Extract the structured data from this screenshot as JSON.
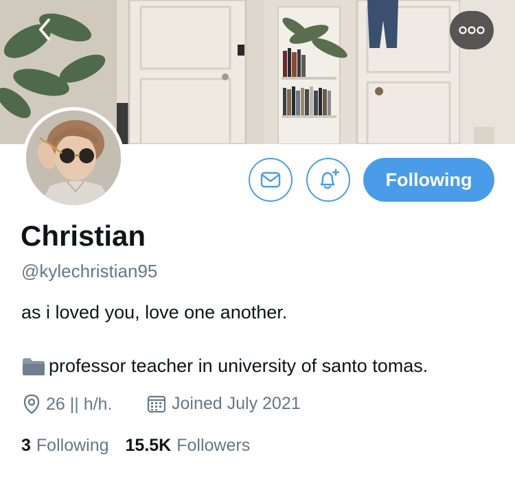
{
  "header": {
    "back_icon": "chevron-left-icon",
    "more_icon": "more-options-icon"
  },
  "profile": {
    "name": "Christian",
    "handle": "@kylechristian95",
    "bio_line1": "as i loved you, love one another.",
    "bio_line2": "professor teacher in university of santo tomas.",
    "location": "26 || h/h.",
    "joined": "Joined July 2021"
  },
  "actions": {
    "following_label": "Following"
  },
  "stats": {
    "following_count": "3",
    "following_label": "Following",
    "followers_count": "15.5K",
    "followers_label": "Followers"
  },
  "colors": {
    "accent": "#4a9ce8",
    "text": "#0f1419",
    "muted": "#667785"
  }
}
